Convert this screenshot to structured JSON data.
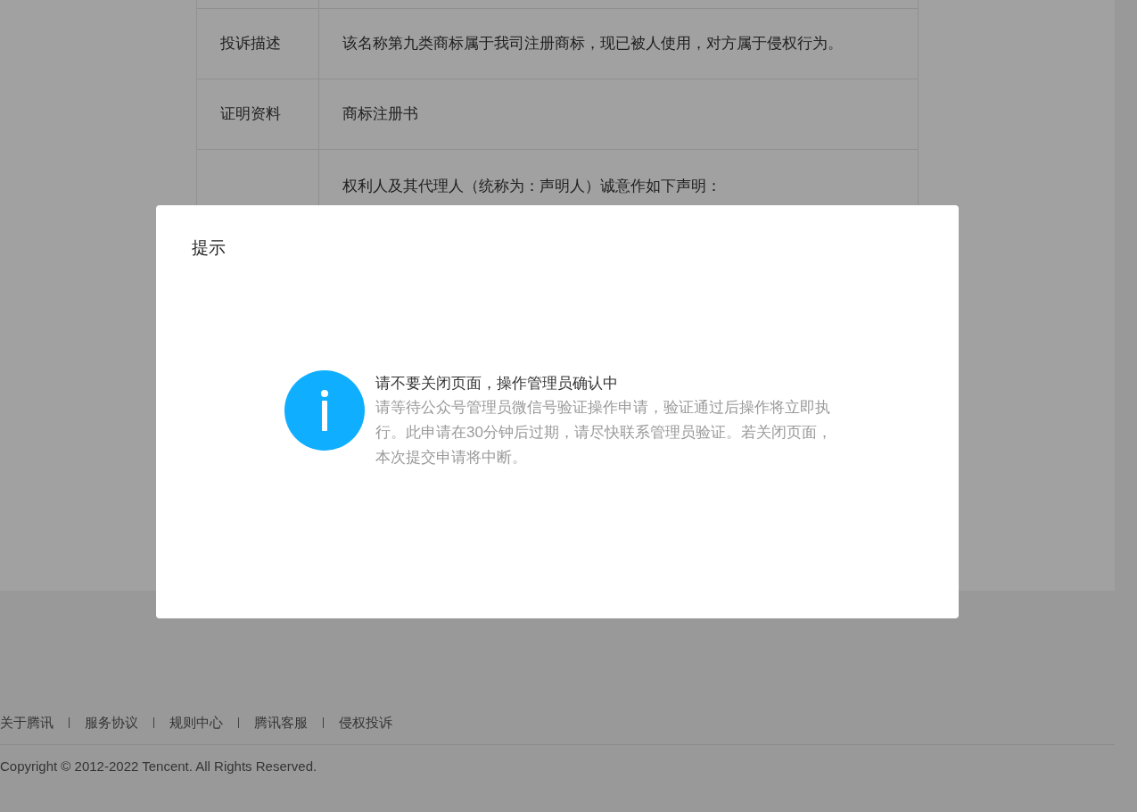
{
  "table": {
    "rows": [
      {
        "label": "投诉描述",
        "value": "该名称第九类商标属于我司注册商标，现已被人使用，对方属于侵权行为。"
      },
      {
        "label": "证明资料",
        "value": "商标注册书"
      },
      {
        "value": "权利人及其代理人（统称为：声明人）诚意作如下声明："
      }
    ]
  },
  "footer": {
    "links": [
      "关于腾讯",
      "服务协议",
      "规则中心",
      "腾讯客服",
      "侵权投诉"
    ],
    "copyright": "Copyright © 2012-2022 Tencent. All Rights Reserved."
  },
  "dialog": {
    "title": "提示",
    "heading": "请不要关闭页面，操作管理员确认中",
    "message": "请等待公众号管理员微信号验证操作申请，验证通过后操作将立即执行。此申请在30分钟后过期，请尽快联系管理员验证。若关闭页面，本次提交申请将中断。"
  }
}
